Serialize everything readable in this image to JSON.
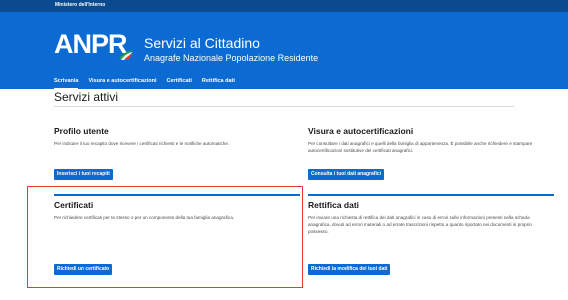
{
  "topbar": {
    "ministry": "Ministero dell'Interno"
  },
  "header": {
    "logo": "ANPR",
    "title": "Servizi al Cittadino",
    "subtitle": "Anagrafe Nazionale Popolazione Residente"
  },
  "nav": {
    "items": [
      {
        "label": "Scrivania",
        "active": true
      },
      {
        "label": "Visura e autocertificazioni",
        "active": false
      },
      {
        "label": "Certificati",
        "active": false
      },
      {
        "label": "Rettifica dati",
        "active": false
      }
    ]
  },
  "main": {
    "title": "Servizi attivi",
    "cards": [
      {
        "title": "Profilo utente",
        "desc": "Per indicare il tuo recapito dove ricevere i certificati richiesti e le notifiche automatiche.",
        "button": "Inserisci i tuoi recapiti"
      },
      {
        "title": "Visura e autocertificazioni",
        "desc": "Per consultare i dati anagrafici e quelli della famiglia di appartenenza. È possibile anche richiedere e stampare autocertificazioni sostitutive dei certificati anagrafici.",
        "button": "Consulta i tuoi dati anagrafici"
      },
      {
        "title": "Certificati",
        "desc": "Per richiedere certificati per te stesso o per un componente della tua famiglia anagrafica.",
        "button": "Richiedi un certificato"
      },
      {
        "title": "Rettifica dati",
        "desc": "Per inviare una richiesta di rettifica dei dati anagrafici in caso di errori sulle informazioni presenti nella scheda anagrafica, dovuti ad errori materiali o ad errate trascrizioni rispetto a quanto riportato nei documenti in proprio possesso.",
        "button": "Richiedi la modifica dei tuoi dati"
      }
    ]
  },
  "colors": {
    "header_blue": "#0b6bd3",
    "topbar_blue": "#0a4a8f",
    "highlight_red": "#e53935"
  }
}
